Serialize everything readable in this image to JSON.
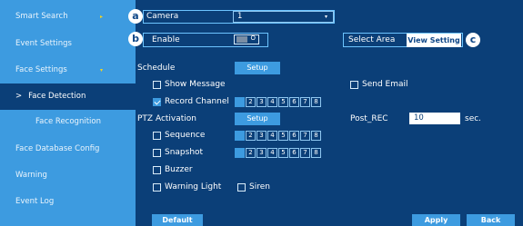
{
  "sidebar": {
    "items": [
      {
        "label": "Smart Search",
        "expander": "▸"
      },
      {
        "label": "Event Settings"
      },
      {
        "label": "Face Settings",
        "expander": "▾"
      },
      {
        "label": "Face Detection",
        "prefix": ">"
      },
      {
        "label": "Face Recognition"
      },
      {
        "label": "Face Database Config"
      },
      {
        "label": "Warning"
      },
      {
        "label": "Event Log"
      }
    ]
  },
  "callouts": {
    "a": "a",
    "b": "b",
    "c": "c"
  },
  "camera": {
    "label": "Camera",
    "value": "1",
    "caret": "▾"
  },
  "enable": {
    "label": "Enable",
    "toggle_text": "O"
  },
  "area": {
    "label": "Select Area",
    "button": "View Setting"
  },
  "schedule": {
    "label": "Schedule",
    "button": "Setup"
  },
  "options": {
    "show_message": "Show Message",
    "send_email": "Send Email",
    "record_channel": "Record Channel",
    "sequence": "Sequence",
    "snapshot": "Snapshot",
    "buzzer": "Buzzer",
    "warning_light": "Warning Light",
    "siren": "Siren"
  },
  "channels": [
    "1",
    "2",
    "3",
    "4",
    "5",
    "6",
    "7",
    "8"
  ],
  "ptz": {
    "label": "PTZ Activation",
    "button": "Setup"
  },
  "post_rec": {
    "label": "Post_REC",
    "value": "10",
    "unit": "sec."
  },
  "footer": {
    "default": "Default",
    "apply": "Apply",
    "back": "Back"
  },
  "colors": {
    "sidebar": "#3d9be0",
    "background": "#0b3f78",
    "accent": "#3d9be0",
    "highlight": "#6cc4ff",
    "arrow": "#f4d21f"
  }
}
